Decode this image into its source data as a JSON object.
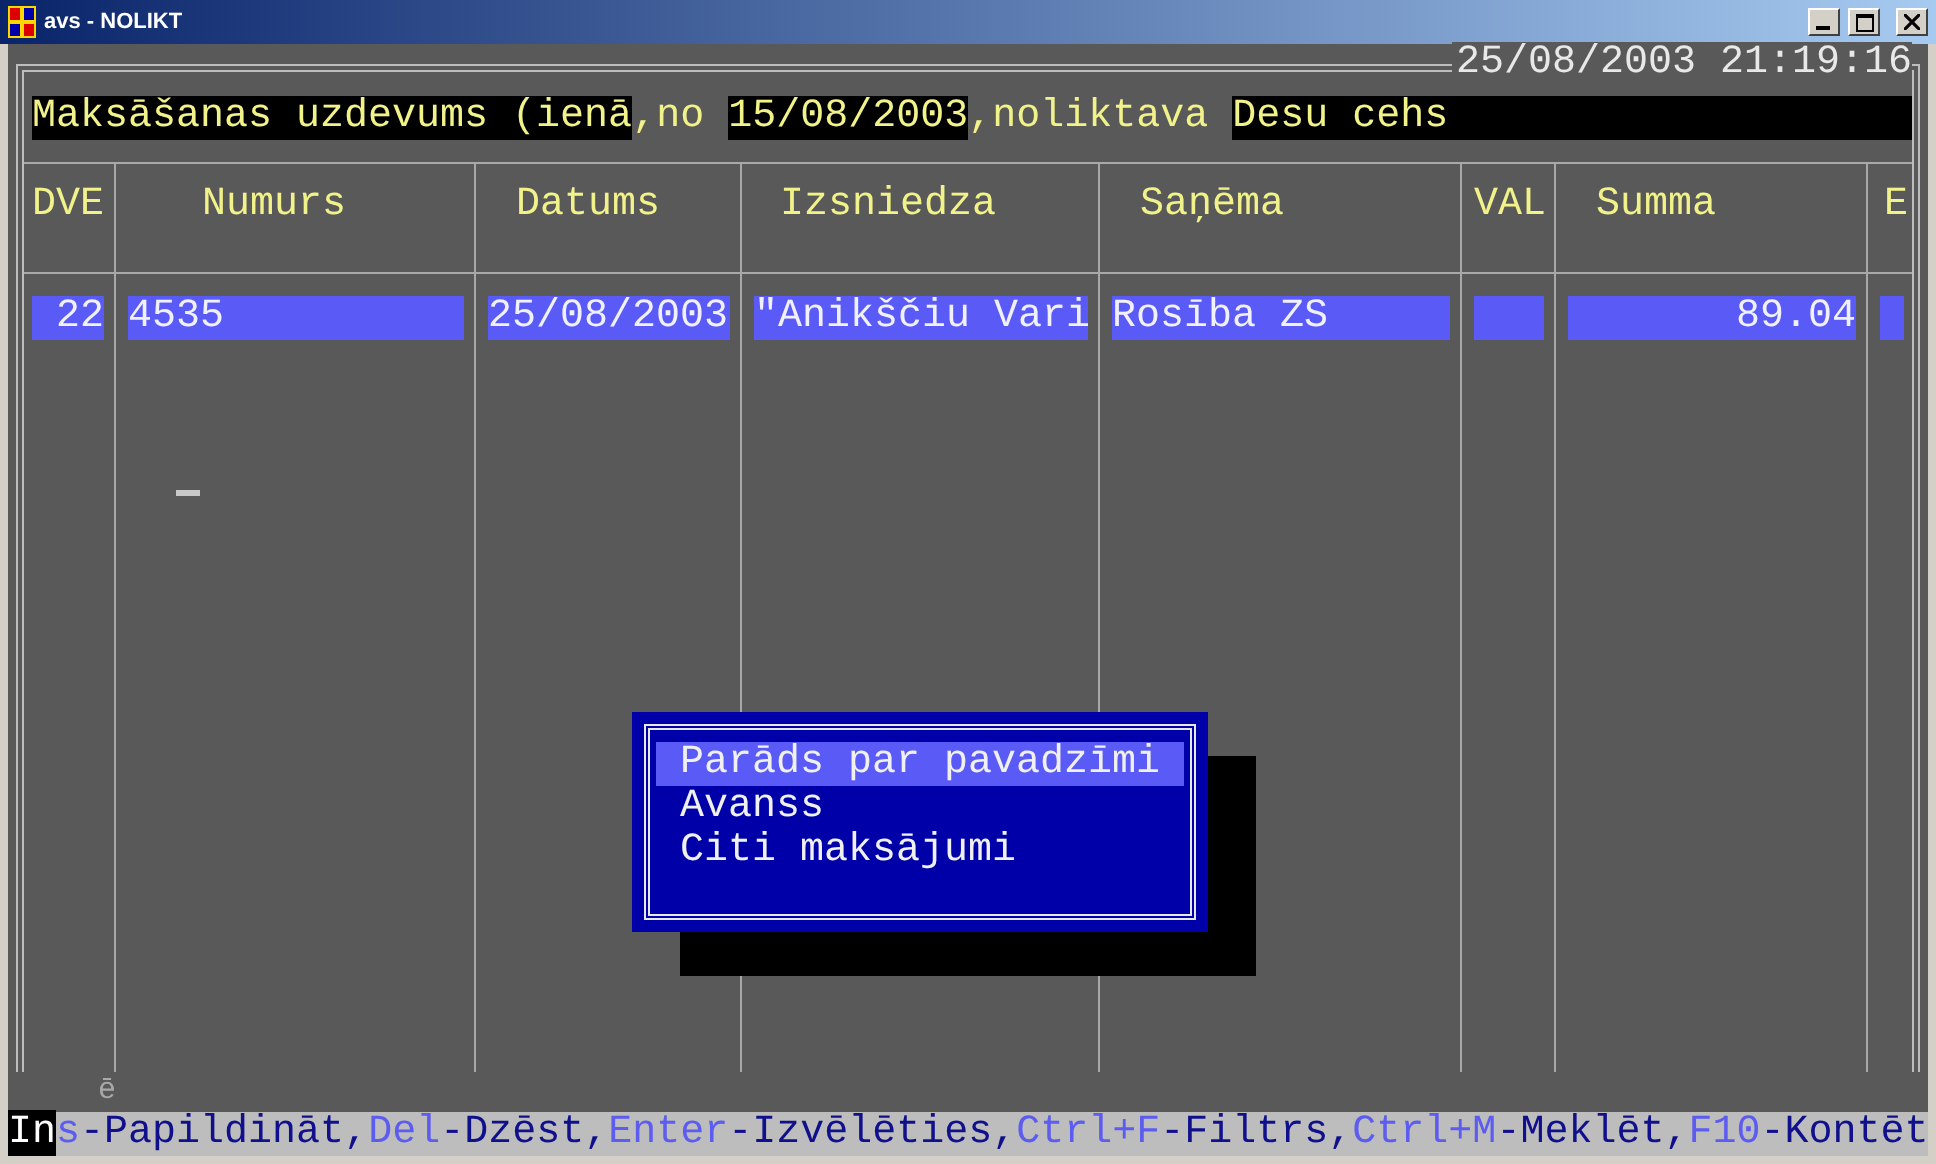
{
  "window": {
    "title": "avs - NOLIKT"
  },
  "datetime": "25/08/2003 21:19:16",
  "header_segments": [
    {
      "text": "Maksāšanas uzdevums (ienā",
      "kind": "field"
    },
    {
      "text": ",no ",
      "kind": "label"
    },
    {
      "text": "15/08/2003",
      "kind": "field"
    },
    {
      "text": ",noliktava ",
      "kind": "label"
    },
    {
      "text": "Desu cehs",
      "kind": "field"
    }
  ],
  "table": {
    "columns": [
      {
        "label": "DVE",
        "kind": "number"
      },
      {
        "label": "Numurs",
        "kind": "text"
      },
      {
        "label": "Datums",
        "kind": "text"
      },
      {
        "label": "Izsniedza",
        "kind": "text"
      },
      {
        "label": "Saņēma",
        "kind": "text"
      },
      {
        "label": "VAL",
        "kind": "text"
      },
      {
        "label": "Summa",
        "kind": "number"
      },
      {
        "label": "E",
        "kind": "text"
      }
    ],
    "rows": [
      {
        "selected": true,
        "cells": [
          "22",
          "4535",
          "25/08/2003",
          "\"Anikščiu Vari",
          "Rosība ZS",
          null,
          "89.04",
          null
        ]
      }
    ]
  },
  "stray_char": "ē",
  "menu": {
    "items": [
      {
        "label": "Parāds par pavadzīmi",
        "selected": true
      },
      {
        "label": "Avanss",
        "selected": false
      },
      {
        "label": "Citi maksājumi",
        "selected": false
      }
    ]
  },
  "status_bar": {
    "hotkeys": [
      {
        "cursor_text": "In",
        "key": "s",
        "label": "-Papildināt,"
      },
      {
        "key": "Del",
        "label": "-Dzēst,"
      },
      {
        "key": "Enter",
        "label": "-Izvēlēties,"
      },
      {
        "key": "Ctrl+F",
        "label": "-Filtrs,"
      },
      {
        "key": "Ctrl+M",
        "label": "-Meklēt,"
      },
      {
        "key": "F10",
        "label": "-Kontēt"
      }
    ]
  }
}
